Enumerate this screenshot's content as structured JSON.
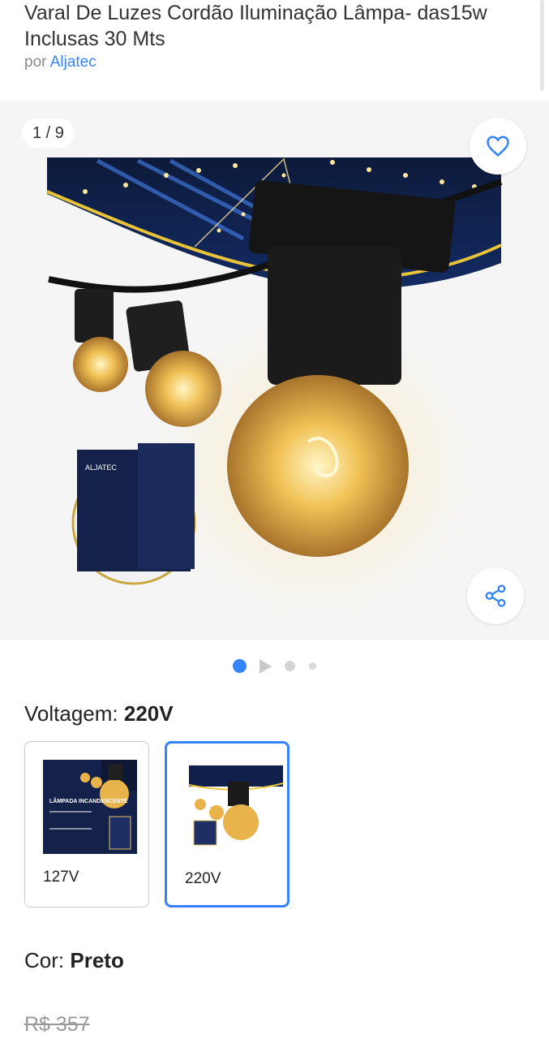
{
  "product": {
    "title": "Varal De Luzes Cordão Iluminação Lâmpa- das15w Inclusas 30 Mts",
    "seller_prefix": "por",
    "seller_name": "Aljatec"
  },
  "gallery": {
    "counter": "1 / 9",
    "box_brand": "ALJATEC",
    "icons": [
      "heart-icon",
      "share-icon"
    ],
    "dots_count": 4,
    "active_dot": 0
  },
  "voltage": {
    "label": "Voltagem:",
    "selected": "220V",
    "options": [
      {
        "label": "127V",
        "thumb_title": "LÂMPADA INCANDESCENTE"
      },
      {
        "label": "220V"
      }
    ]
  },
  "color": {
    "label": "Cor:",
    "selected": "Preto"
  },
  "price": {
    "old": "R$ 357"
  },
  "colors": {
    "accent": "#3483fa",
    "gallery_bg": "#f5f5f5",
    "text": "#333333",
    "muted": "#8a8a8a"
  }
}
